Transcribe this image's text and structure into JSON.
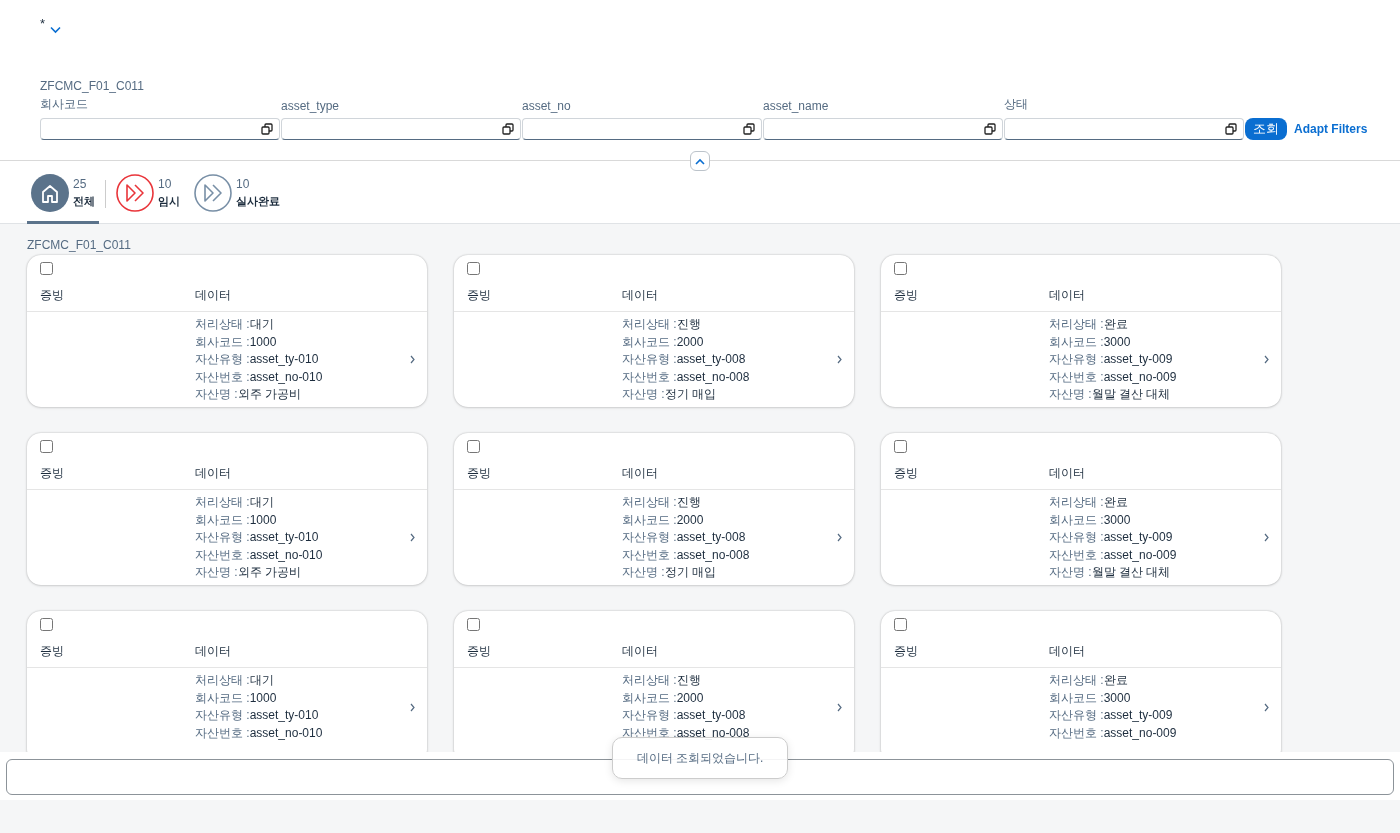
{
  "variant": {
    "title": "*"
  },
  "filter_bar": {
    "title": "ZFCMC_F01_C011",
    "fields": [
      {
        "label": "회사코드"
      },
      {
        "label": "asset_type"
      },
      {
        "label": "asset_no"
      },
      {
        "label": "asset_name"
      },
      {
        "label": "상태"
      }
    ],
    "go_button": "조회",
    "adapt_link": "Adapt Filters"
  },
  "tabs": [
    {
      "count": "25",
      "label": "전체",
      "kind": "home",
      "color": "#5b738b",
      "selected": true
    },
    {
      "count": "10",
      "label": "임시",
      "kind": "forward",
      "color": "#e9353a",
      "selected": false
    },
    {
      "count": "10",
      "label": "실사완료",
      "kind": "forward",
      "color": "#788fa6",
      "selected": false
    }
  ],
  "list": {
    "title": "ZFCMC_F01_C011",
    "cards": [
      {
        "checked": false,
        "columns": [
          "증빙",
          "데이터"
        ],
        "fields": [
          {
            "label": "처리상태 :",
            "value": "대기"
          },
          {
            "label": "회사코드 :",
            "value": "1000"
          },
          {
            "label": "자산유형 :",
            "value": "asset_ty-010"
          },
          {
            "label": "자산번호 :",
            "value": "asset_no-010"
          },
          {
            "label": "자산명 :",
            "value": "외주 가공비"
          }
        ]
      },
      {
        "checked": false,
        "columns": [
          "증빙",
          "데이터"
        ],
        "fields": [
          {
            "label": "처리상태 :",
            "value": "진행"
          },
          {
            "label": "회사코드 :",
            "value": "2000"
          },
          {
            "label": "자산유형 :",
            "value": "asset_ty-008"
          },
          {
            "label": "자산번호 :",
            "value": "asset_no-008"
          },
          {
            "label": "자산명 :",
            "value": "정기 매입"
          }
        ]
      },
      {
        "checked": false,
        "columns": [
          "증빙",
          "데이터"
        ],
        "fields": [
          {
            "label": "처리상태 :",
            "value": "완료"
          },
          {
            "label": "회사코드 :",
            "value": "3000"
          },
          {
            "label": "자산유형 :",
            "value": "asset_ty-009"
          },
          {
            "label": "자산번호 :",
            "value": "asset_no-009"
          },
          {
            "label": "자산명 :",
            "value": "월말 결산 대체"
          }
        ]
      },
      {
        "checked": false,
        "columns": [
          "증빙",
          "데이터"
        ],
        "fields": [
          {
            "label": "처리상태 :",
            "value": "대기"
          },
          {
            "label": "회사코드 :",
            "value": "1000"
          },
          {
            "label": "자산유형 :",
            "value": "asset_ty-010"
          },
          {
            "label": "자산번호 :",
            "value": "asset_no-010"
          },
          {
            "label": "자산명 :",
            "value": "외주 가공비"
          }
        ]
      },
      {
        "checked": false,
        "columns": [
          "증빙",
          "데이터"
        ],
        "fields": [
          {
            "label": "처리상태 :",
            "value": "진행"
          },
          {
            "label": "회사코드 :",
            "value": "2000"
          },
          {
            "label": "자산유형 :",
            "value": "asset_ty-008"
          },
          {
            "label": "자산번호 :",
            "value": "asset_no-008"
          },
          {
            "label": "자산명 :",
            "value": "정기 매입"
          }
        ]
      },
      {
        "checked": false,
        "columns": [
          "증빙",
          "데이터"
        ],
        "fields": [
          {
            "label": "처리상태 :",
            "value": "완료"
          },
          {
            "label": "회사코드 :",
            "value": "3000"
          },
          {
            "label": "자산유형 :",
            "value": "asset_ty-009"
          },
          {
            "label": "자산번호 :",
            "value": "asset_no-009"
          },
          {
            "label": "자산명 :",
            "value": "월말 결산 대체"
          }
        ]
      },
      {
        "checked": false,
        "columns": [
          "증빙",
          "데이터"
        ],
        "fields": [
          {
            "label": "처리상태 :",
            "value": "대기"
          },
          {
            "label": "회사코드 :",
            "value": "1000"
          },
          {
            "label": "자산유형 :",
            "value": "asset_ty-010"
          },
          {
            "label": "자산번호 :",
            "value": "asset_no-010"
          }
        ]
      },
      {
        "checked": false,
        "columns": [
          "증빙",
          "데이터"
        ],
        "fields": [
          {
            "label": "처리상태 :",
            "value": "진행"
          },
          {
            "label": "회사코드 :",
            "value": "2000"
          },
          {
            "label": "자산유형 :",
            "value": "asset_ty-008"
          },
          {
            "label": "자산번호 :",
            "value": "asset_no-008"
          }
        ]
      },
      {
        "checked": false,
        "columns": [
          "증빙",
          "데이터"
        ],
        "fields": [
          {
            "label": "처리상태 :",
            "value": "완료"
          },
          {
            "label": "회사코드 :",
            "value": "3000"
          },
          {
            "label": "자산유형 :",
            "value": "asset_ty-009"
          },
          {
            "label": "자산번호 :",
            "value": "asset_no-009"
          }
        ]
      }
    ]
  },
  "toast": {
    "message": "데이터 조회되었습니다."
  }
}
